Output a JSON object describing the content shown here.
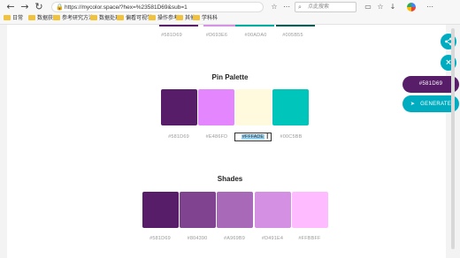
{
  "browser": {
    "url": "https://mycolor.space/?hex=%23581D69&sub=1",
    "search_placeholder": "点此搜索",
    "nav": {
      "back": "←",
      "forward": "→",
      "reload": "↻",
      "home": "⌂"
    },
    "lock_icon": "🔒",
    "bookmarks": [
      "日常",
      "数据获取",
      "参考研究方法",
      "数据处理",
      "偏看可视学",
      "操作参考",
      "其他",
      "学科科"
    ]
  },
  "top_palette": {
    "hex_values": [
      "#581D69",
      "#D693E6",
      "#00ADA0",
      "#005B55"
    ]
  },
  "pin_palette": {
    "title": "Pin Palette",
    "colors": [
      "#581D69",
      "#E486FD",
      "#FFFADE",
      "#00C5BB"
    ],
    "hex_labels": [
      "#581D69",
      "#E486FD",
      "#FFFADE",
      "#00C5BB"
    ]
  },
  "shades": {
    "title": "Shades",
    "colors": [
      "#581D69",
      "#804390",
      "#A969B9",
      "#D491E4",
      "#FFBBFF"
    ],
    "hex_labels": [
      "#581D69",
      "#804390",
      "#A969B9",
      "#D491E4",
      "#FFBBFF"
    ]
  },
  "sidebar": {
    "share_icon": "share-icon",
    "close_icon": "×",
    "color_pill": "#581D69",
    "generate_label": "GENERATE",
    "generate_icon": "➤"
  },
  "colors": {
    "accent_teal": "#00adc0",
    "pill_purple": "#581d69"
  }
}
